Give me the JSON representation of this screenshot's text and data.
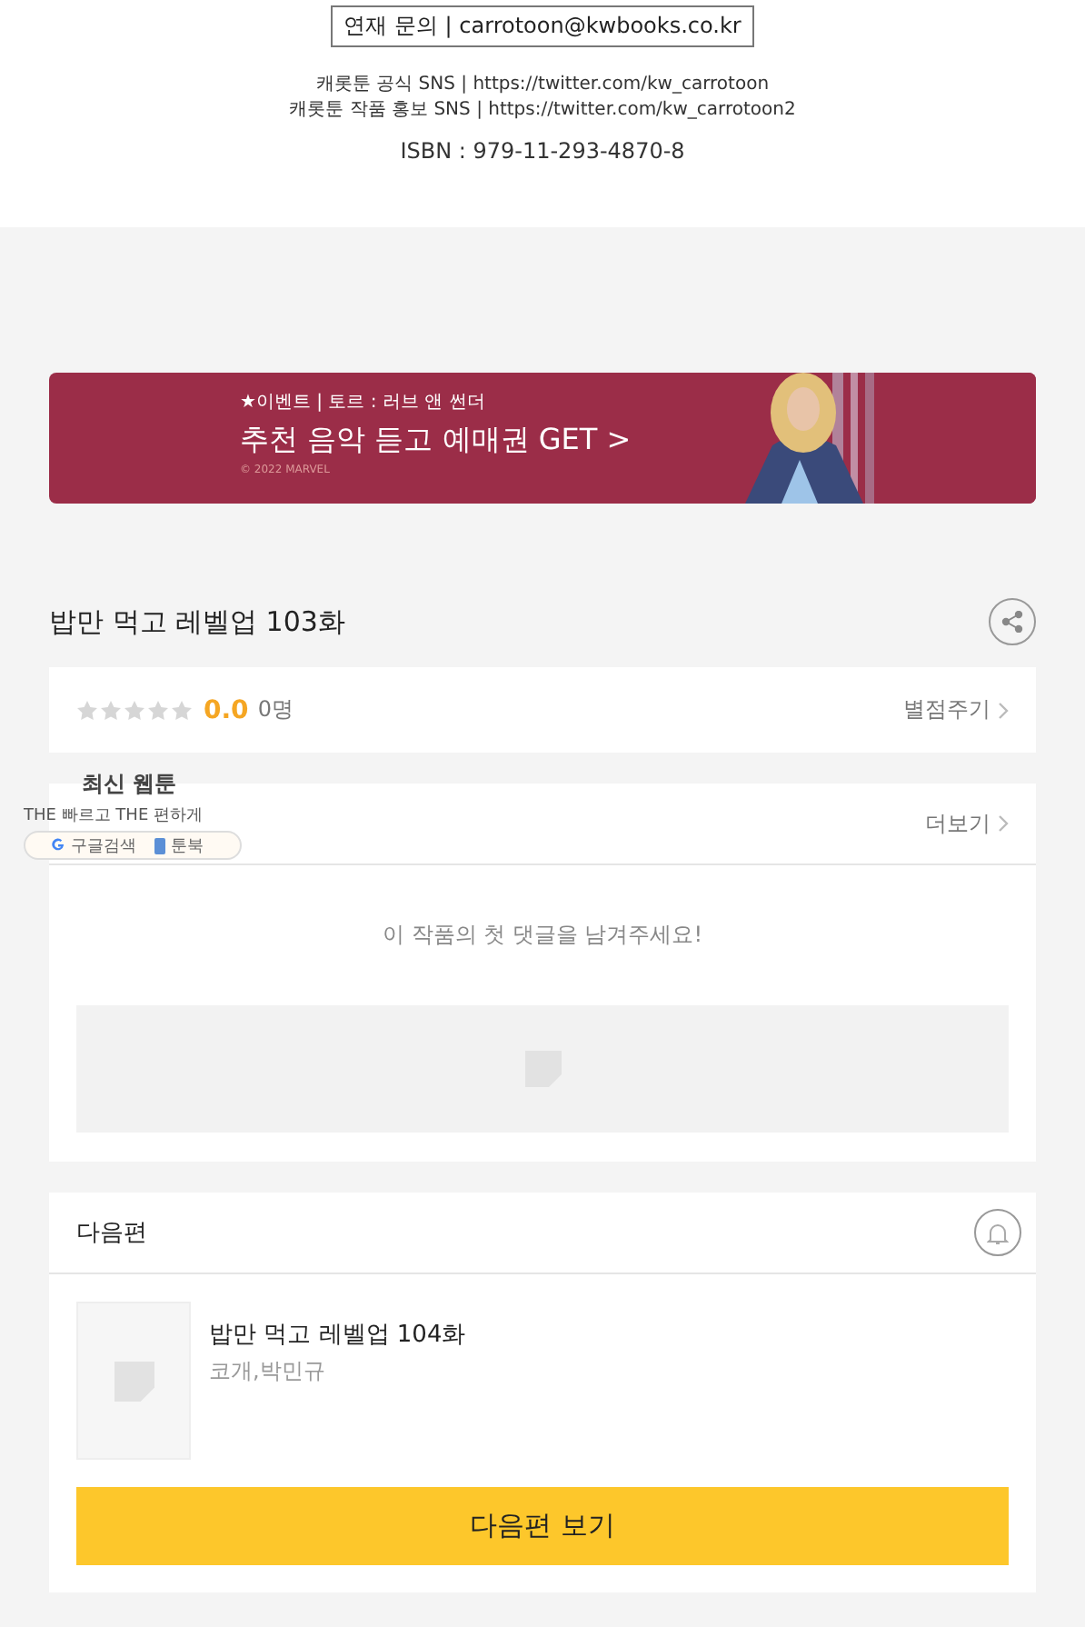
{
  "footer_info": {
    "contact": "연재 문의 | carrotoon@kwbooks.co.kr",
    "sns": [
      "캐롯툰 공식 SNS | https://twitter.com/kw_carrotoon",
      "캐롯툰 작품 홍보 SNS | https://twitter.com/kw_carrotoon2"
    ],
    "isbn": "ISBN : 979-11-293-4870-8"
  },
  "banner": {
    "kind": "picture",
    "label": "★이벤트 | 토르 : 러브 앤 썬더",
    "headline": "추천 음악 듣고 예매권 GET >",
    "copyright": "© 2022 MARVEL"
  },
  "episode_title": "밥만 먹고 레벨업 103화",
  "rating": {
    "stars": 0,
    "score": "0.0",
    "count": "0명",
    "action": "별점주기"
  },
  "comments": {
    "more": "더보기",
    "empty_message": "이 작품의 첫 댓글을 남겨주세요!"
  },
  "overlay": {
    "title": "최신 웹툰",
    "tagline": "THE 빠르고 THE 편하게",
    "links": [
      "구글검색",
      "툰북"
    ]
  },
  "next": {
    "title": "다음편",
    "episode": "밥만 먹고 레벨업 104화",
    "authors": "코개,박민규",
    "button": "다음편 보기"
  }
}
